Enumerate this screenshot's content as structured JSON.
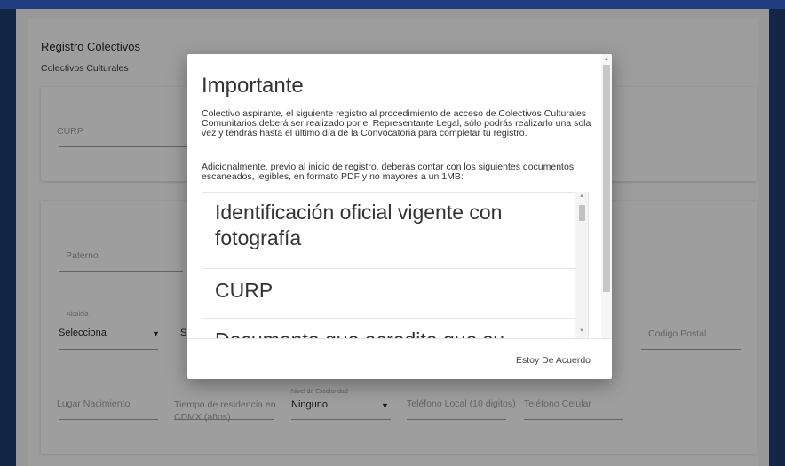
{
  "colors": {
    "topbar": "#2f55b3",
    "background": "#1c3561",
    "page": "#d4d4d4",
    "modal": "#ffffff"
  },
  "form": {
    "section_title": "Registro Colectivos",
    "section_subtitle": "Colectivos Culturales",
    "curp_label": "CURP",
    "paterno_label": "Paterno",
    "alcaldia_label": "Alcaldia",
    "alcaldia_value": "Selecciona",
    "second_select_partial": "S",
    "codigo_postal_label": "Codigo Postal",
    "lugar_nacimiento_label": "Lugar Nacimiento",
    "tiempo_residencia_label": "Tiempo de residencia en CDMX (años)",
    "nivel_escolaridad_label": "Nivel de Escolaridad",
    "nivel_escolaridad_value": "Ninguno",
    "telefono_local_label": "Teléfono Local (10 digitos)",
    "telefono_celular_label": "Teléfono Celular",
    "dropdown_icon": "caret-down-icon"
  },
  "modal": {
    "title": "Importante",
    "paragraph1": "Colectivo aspirante, el siguiente registro al procedimiento de acceso de Colectivos Culturales Comunitarios deberá ser realizado por el Representante Legal, sólo podrás realizarlo una sola vez y tendrás hasta el último día de la Convocatoria para completar tu registro.",
    "paragraph2": "Adicionalmente, previo al inicio de registro, deberás contar con los siguientes documentos escaneados, legibles, en formato PDF y no mayores a un 1MB:",
    "documents": [
      "Identificación oficial vigente con fotografía",
      "CURP",
      "Documento que acredite que su"
    ],
    "agree_button": "Estoy De Acuerdo"
  }
}
